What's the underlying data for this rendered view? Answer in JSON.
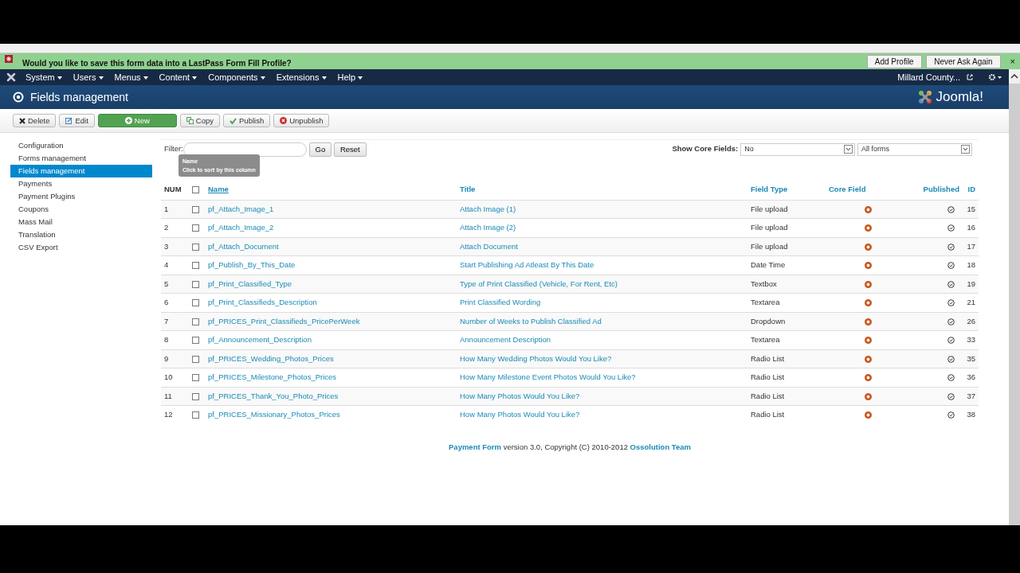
{
  "lastpass_bar": {
    "message": "Would you like to save this form data into a LastPass Form Fill Profile?",
    "buttons": [
      "Add Profile",
      "Never Ask Again"
    ],
    "close": "×"
  },
  "navbar": {
    "menus": [
      "System",
      "Users",
      "Menus",
      "Content",
      "Components",
      "Extensions",
      "Help"
    ],
    "site": "Millard County..."
  },
  "header": {
    "title": "Fields management",
    "logo": "Joomla!"
  },
  "toolbar": [
    {
      "label": "Delete",
      "kind": "delete"
    },
    {
      "label": "Edit",
      "kind": "edit"
    },
    {
      "label": "New",
      "kind": "new"
    },
    {
      "label": "Copy",
      "kind": "copy"
    },
    {
      "label": "Publish",
      "kind": "publish"
    },
    {
      "label": "Unpublish",
      "kind": "unpublish"
    }
  ],
  "sidebar": {
    "items": [
      {
        "label": "Configuration",
        "selected": false
      },
      {
        "label": "Forms management",
        "selected": false
      },
      {
        "label": "Fields management",
        "selected": true
      },
      {
        "label": "Payments",
        "selected": false
      },
      {
        "label": "Payment Plugins",
        "selected": false
      },
      {
        "label": "Coupons",
        "selected": false
      },
      {
        "label": "Mass Mail",
        "selected": false
      },
      {
        "label": "Translation",
        "selected": false
      },
      {
        "label": "CSV Export",
        "selected": false
      }
    ]
  },
  "filter": {
    "label": "Filter:",
    "buttons": [
      "Go",
      "Reset"
    ],
    "core_label": "Show Core Fields:",
    "core_value": "No",
    "form_value": "All forms"
  },
  "tooltip": {
    "title": "Name",
    "text": "Click to sort by this column"
  },
  "table": {
    "select_all_checked": false,
    "columns": [
      "NUM",
      "Name",
      "Title",
      "Field Type",
      "Core Field",
      "Published",
      "ID"
    ],
    "rows": [
      {
        "num": "1",
        "name": "pf_Attach_Image_1",
        "title": "Attach Image (1)",
        "type": "File upload",
        "core": true,
        "published": true,
        "checked": false,
        "id": "15"
      },
      {
        "num": "2",
        "name": "pf_Attach_Image_2",
        "title": "Attach Image (2)",
        "type": "File upload",
        "core": true,
        "published": true,
        "checked": false,
        "id": "16"
      },
      {
        "num": "3",
        "name": "pf_Attach_Document",
        "title": "Attach Document",
        "type": "File upload",
        "core": true,
        "published": true,
        "checked": false,
        "id": "17"
      },
      {
        "num": "4",
        "name": "pf_Publish_By_This_Date",
        "title": "Start Publishing Ad Atleast By This Date",
        "type": "Date Time",
        "core": true,
        "published": true,
        "checked": false,
        "id": "18"
      },
      {
        "num": "5",
        "name": "pf_Print_Classified_Type",
        "title": "Type of Print Classified (Vehicle, For Rent, Etc)",
        "type": "Textbox",
        "core": true,
        "published": true,
        "checked": false,
        "id": "19"
      },
      {
        "num": "6",
        "name": "pf_Print_Classifieds_Description",
        "title": "Print Classified Wording",
        "type": "Textarea",
        "core": true,
        "published": true,
        "checked": false,
        "id": "21"
      },
      {
        "num": "7",
        "name": "pf_PRICES_Print_Classifieds_PricePerWeek",
        "title": "Number of Weeks to Publish Classified Ad",
        "type": "Dropdown",
        "core": true,
        "published": true,
        "checked": false,
        "id": "26"
      },
      {
        "num": "8",
        "name": "pf_Announcement_Description",
        "title": "Announcement Description",
        "type": "Textarea",
        "core": true,
        "published": true,
        "checked": false,
        "id": "33"
      },
      {
        "num": "9",
        "name": "pf_PRICES_Wedding_Photos_Prices",
        "title": "How Many Wedding Photos Would You Like?",
        "type": "Radio List",
        "core": true,
        "published": true,
        "checked": false,
        "id": "35"
      },
      {
        "num": "10",
        "name": "pf_PRICES_Milestone_Photos_Prices",
        "title": "How Many Milestone Event Photos Would You Like?",
        "type": "Radio List",
        "core": true,
        "published": true,
        "checked": false,
        "id": "36"
      },
      {
        "num": "11",
        "name": "pf_PRICES_Thank_You_Photo_Prices",
        "title": "How Many Photos Would You Like?",
        "type": "Radio List",
        "core": true,
        "published": true,
        "checked": false,
        "id": "37"
      },
      {
        "num": "12",
        "name": "pf_PRICES_Missionary_Photos_Prices",
        "title": "How Many Photos Would You Like?",
        "type": "Radio List",
        "core": true,
        "published": true,
        "checked": false,
        "id": "38"
      }
    ]
  },
  "footer": {
    "product": "Payment Form",
    "text": "version 3.0, Copyright (C) 2010-2012",
    "team": "Ossolution Team"
  }
}
